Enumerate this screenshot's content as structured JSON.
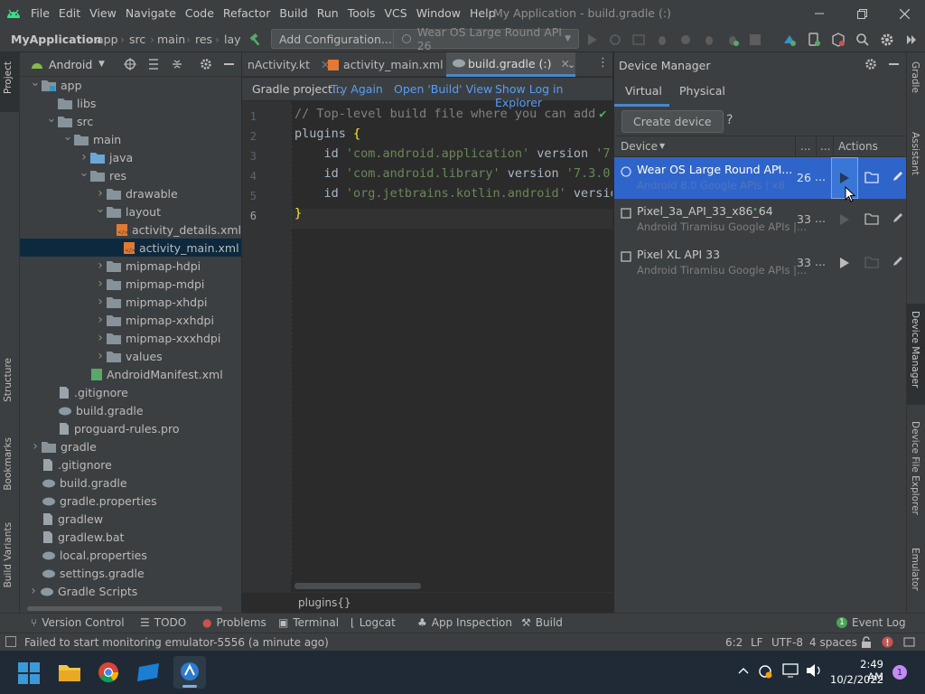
{
  "menu": {
    "items": [
      "File",
      "Edit",
      "View",
      "Navigate",
      "Code",
      "Refactor",
      "Build",
      "Run",
      "Tools",
      "VCS",
      "Window",
      "Help"
    ],
    "window_title": "My Application - build.gradle (:)"
  },
  "navbar": {
    "breadcrumbs": [
      "MyApplication",
      "app",
      "src",
      "main",
      "res",
      "lay"
    ],
    "add_config": "Add Configuration...",
    "device_selector": "Wear OS Large Round API 26"
  },
  "left_strip": {
    "project": "Project",
    "structure": "Structure",
    "bookmarks": "Bookmarks",
    "build_variants": "Build Variants"
  },
  "right_strip": {
    "gradle": "Gradle",
    "assistant": "Assistant",
    "device_manager": "Device Manager",
    "device_file_explorer": "Device File Explorer",
    "emulator": "Emulator"
  },
  "project": {
    "view_mode": "Android",
    "tree": [
      {
        "label": "app",
        "depth": 0,
        "expanded": true,
        "type": "module"
      },
      {
        "label": "libs",
        "depth": 1,
        "expanded": null,
        "type": "folder"
      },
      {
        "label": "src",
        "depth": 1,
        "expanded": true,
        "type": "folder"
      },
      {
        "label": "main",
        "depth": 2,
        "expanded": true,
        "type": "folder"
      },
      {
        "label": "java",
        "depth": 3,
        "expanded": false,
        "type": "folder-blue"
      },
      {
        "label": "res",
        "depth": 3,
        "expanded": true,
        "type": "folder"
      },
      {
        "label": "drawable",
        "depth": 4,
        "expanded": false,
        "type": "folder"
      },
      {
        "label": "layout",
        "depth": 4,
        "expanded": true,
        "type": "folder"
      },
      {
        "label": "activity_details.xml",
        "depth": 5,
        "expanded": null,
        "type": "xml"
      },
      {
        "label": "activity_main.xml",
        "depth": 5,
        "expanded": null,
        "type": "xml",
        "selected": true
      },
      {
        "label": "mipmap-hdpi",
        "depth": 4,
        "expanded": false,
        "type": "folder"
      },
      {
        "label": "mipmap-mdpi",
        "depth": 4,
        "expanded": false,
        "type": "folder"
      },
      {
        "label": "mipmap-xhdpi",
        "depth": 4,
        "expanded": false,
        "type": "folder"
      },
      {
        "label": "mipmap-xxhdpi",
        "depth": 4,
        "expanded": false,
        "type": "folder"
      },
      {
        "label": "mipmap-xxxhdpi",
        "depth": 4,
        "expanded": false,
        "type": "folder"
      },
      {
        "label": "values",
        "depth": 4,
        "expanded": false,
        "type": "folder"
      },
      {
        "label": "AndroidManifest.xml",
        "depth": 3,
        "expanded": null,
        "type": "manifest"
      },
      {
        "label": ".gitignore",
        "depth": 1,
        "expanded": null,
        "type": "file"
      },
      {
        "label": "build.gradle",
        "depth": 1,
        "expanded": null,
        "type": "gradle"
      },
      {
        "label": "proguard-rules.pro",
        "depth": 1,
        "expanded": null,
        "type": "file"
      },
      {
        "label": "gradle",
        "depth": 0,
        "expanded": false,
        "type": "folder"
      },
      {
        "label": ".gitignore",
        "depth": 0,
        "expanded": null,
        "type": "file"
      },
      {
        "label": "build.gradle",
        "depth": 0,
        "expanded": null,
        "type": "gradle"
      },
      {
        "label": "gradle.properties",
        "depth": 0,
        "expanded": null,
        "type": "gradle"
      },
      {
        "label": "gradlew",
        "depth": 0,
        "expanded": null,
        "type": "file"
      },
      {
        "label": "gradlew.bat",
        "depth": 0,
        "expanded": null,
        "type": "file"
      },
      {
        "label": "local.properties",
        "depth": 0,
        "expanded": null,
        "type": "gradle"
      },
      {
        "label": "settings.gradle",
        "depth": 0,
        "expanded": null,
        "type": "gradle"
      },
      {
        "label": "Gradle Scripts",
        "depth": -1,
        "expanded": false,
        "type": "gradle"
      }
    ]
  },
  "editor": {
    "tabs": [
      "nActivity.kt",
      "activity_main.xml",
      "build.gradle (:)"
    ],
    "active_tab": 2,
    "notice": {
      "text": "Gradle project...",
      "try_again": "Try Again",
      "open_build": "Open 'Build' View",
      "show_log": "Show Log in Explorer"
    },
    "lines": [
      "1",
      "2",
      "3",
      "4",
      "5",
      "6"
    ],
    "code": {
      "l1": "// Top-level build file where you can add",
      "l2_kw": "plugins",
      "l2_brace": " {",
      "l3_id": "    id ",
      "l3_str": "'com.android.application'",
      "l3_ver": " version ",
      "l3_vs": "'7.",
      "l4_id": "    id ",
      "l4_str": "'com.android.library'",
      "l4_ver": " version ",
      "l4_vs": "'7.3.0'",
      "l5_id": "    id ",
      "l5_str": "'org.jetbrains.kotlin.android'",
      "l5_ver": " versio",
      "l6": "}"
    },
    "breadcrumb": "plugins{}"
  },
  "device_manager": {
    "title": "Device Manager",
    "tabs": [
      "Virtual",
      "Physical"
    ],
    "create_button": "Create device",
    "help": "?",
    "columns": {
      "device": "Device",
      "api": "...",
      "size": "...",
      "actions": "Actions"
    },
    "devices": [
      {
        "name": "Wear OS Large Round API...",
        "subtitle": "Android 8.0 Google APIs | x8",
        "api": "26",
        "more": "...",
        "selected": true
      },
      {
        "name": "Pixel_3a_API_33_x86_64",
        "subtitle": "Android Tiramisu Google APIs |...",
        "api": "33",
        "more": "...",
        "selected": false
      },
      {
        "name": "Pixel XL API 33",
        "subtitle": "Android Tiramisu Google APIs |...",
        "api": "33",
        "more": "...",
        "selected": false
      }
    ]
  },
  "toolwindows": {
    "items": [
      "Version Control",
      "TODO",
      "Problems",
      "Terminal",
      "Logcat",
      "App Inspection",
      "Build"
    ],
    "event_log": "Event Log",
    "event_count": "1"
  },
  "status": {
    "message": "Failed to start monitoring emulator-5556 (a minute ago)",
    "position": "6:2",
    "line_sep": "LF",
    "encoding": "UTF-8",
    "indent": "4 spaces"
  },
  "taskbar": {
    "time": "2:49 AM",
    "date": "10/2/2022",
    "notifications": "1"
  },
  "colors": {
    "selection": "#2f65ca",
    "tree_selection": "#0d293e",
    "link": "#589df6",
    "accent_green": "#4aa455",
    "error_red": "#c75450"
  }
}
